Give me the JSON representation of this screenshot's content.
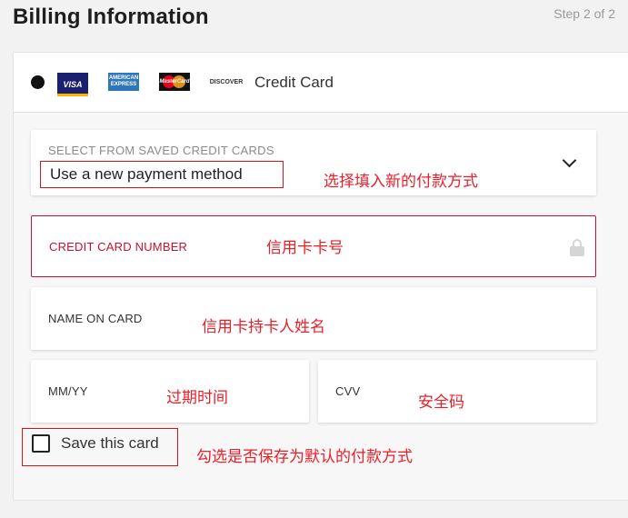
{
  "header": {
    "title": "Billing Information",
    "step": "Step 2 of 2"
  },
  "payment_method": {
    "label": "Credit Card",
    "logos": {
      "visa": "VISA",
      "amex": "AMERICAN EXPRESS",
      "mastercard": "MasterCard",
      "discover": "DISCOVER"
    }
  },
  "saved_cards": {
    "label": "SELECT FROM SAVED CREDIT CARDS",
    "value": "Use a new payment method"
  },
  "fields": {
    "card_number": "CREDIT CARD NUMBER",
    "name_on_card": "NAME ON CARD",
    "expiry": "MM/YY",
    "cvv": "CVV"
  },
  "save_card": {
    "label": "Save this card",
    "checked": false
  },
  "annotations": {
    "saved": "选择填入新的付款方式",
    "card_number": "信用卡卡号",
    "name": "信用卡持卡人姓名",
    "expiry": "过期时间",
    "cvv": "安全码",
    "save": "勾选是否保存为默认的付款方式"
  },
  "colors": {
    "accent": "#c8102e",
    "annotation": "#e8202a"
  }
}
